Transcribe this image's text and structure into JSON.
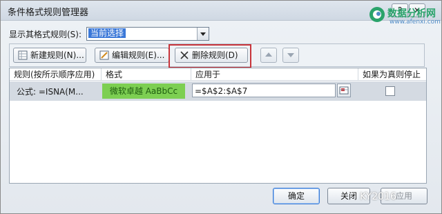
{
  "window": {
    "title": "条件格式规则管理器",
    "help_label": "?",
    "close_label": "✕"
  },
  "brand": {
    "name": "数据分析网",
    "url_text": "www.afenxi.com"
  },
  "show_rules": {
    "label": "显示其格式规则(S):",
    "value": "当前选择"
  },
  "toolbar": {
    "new_label": "新建规则(N)...",
    "edit_label": "编辑规则(E)...",
    "delete_label": "删除规则(D)"
  },
  "table": {
    "headers": {
      "rule": "规则(按所示顺序应用)",
      "format": "格式",
      "applies_to": "应用于",
      "stop_if_true": "如果为真则停止"
    },
    "rows": [
      {
        "rule": "公式: =ISNA(M...",
        "format_preview": "微软卓越  AaBbCc",
        "applies_to": "=$A$2:$A$7",
        "stop_if_true": false
      }
    ]
  },
  "footer": {
    "ok_label": "确定",
    "close_label": "关闭",
    "apply_label": "应用"
  },
  "watermark": "KY2016",
  "colors": {
    "format_preview_bg": "#7dcf52",
    "highlight_border": "#c8343a",
    "selection_bg": "#3b78d8"
  }
}
